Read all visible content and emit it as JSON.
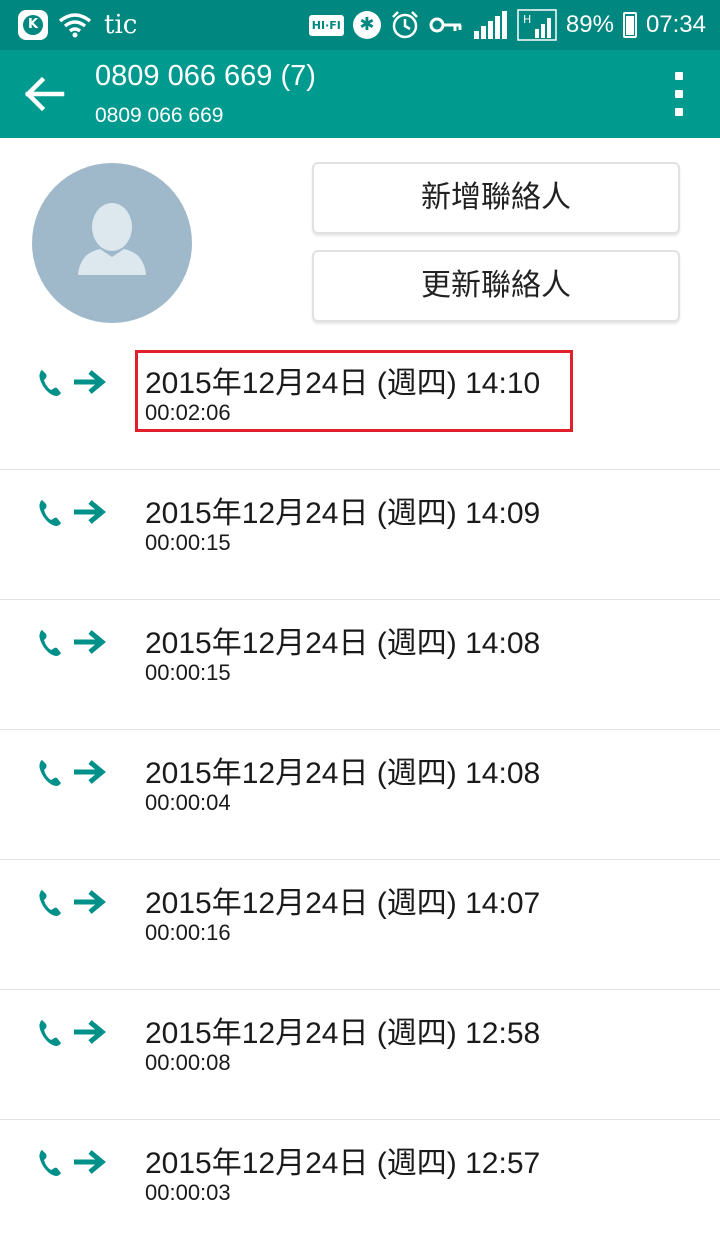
{
  "status_bar": {
    "carrier": "tic",
    "hifi_label": "HI·FI",
    "battery": "89%",
    "time": "07:34",
    "icons": [
      "app-k-icon",
      "wifi-icon",
      "hifi-icon",
      "bluetooth-icon",
      "alarm-icon",
      "key-icon",
      "signal-icon",
      "signal-h-icon",
      "battery-icon"
    ]
  },
  "toolbar": {
    "title": "0809 066 669 (7)",
    "subtitle": "0809 066 669",
    "icons": [
      "back-arrow-icon",
      "more-vert-icon"
    ]
  },
  "contact": {
    "add_label": "新增聯絡人",
    "update_label": "更新聯絡人",
    "avatar_icon": "person-placeholder-icon"
  },
  "calls": [
    {
      "datetime": "2015年12月24日 (週四) 14:10",
      "duration": "00:02:06",
      "type": "outgoing"
    },
    {
      "datetime": "2015年12月24日 (週四) 14:09",
      "duration": "00:00:15",
      "type": "outgoing"
    },
    {
      "datetime": "2015年12月24日 (週四) 14:08",
      "duration": "00:00:15",
      "type": "outgoing"
    },
    {
      "datetime": "2015年12月24日 (週四) 14:08",
      "duration": "00:00:04",
      "type": "outgoing"
    },
    {
      "datetime": "2015年12月24日 (週四) 14:07",
      "duration": "00:00:16",
      "type": "outgoing"
    },
    {
      "datetime": "2015年12月24日 (週四) 12:58",
      "duration": "00:00:08",
      "type": "outgoing"
    },
    {
      "datetime": "2015年12月24日 (週四) 12:57",
      "duration": "00:00:03",
      "type": "outgoing"
    }
  ],
  "colors": {
    "status_bar": "#00877f",
    "toolbar": "#009a8f",
    "accent": "#00908a",
    "highlight": "#e2202c",
    "avatar_bg": "#9fb9cb"
  }
}
